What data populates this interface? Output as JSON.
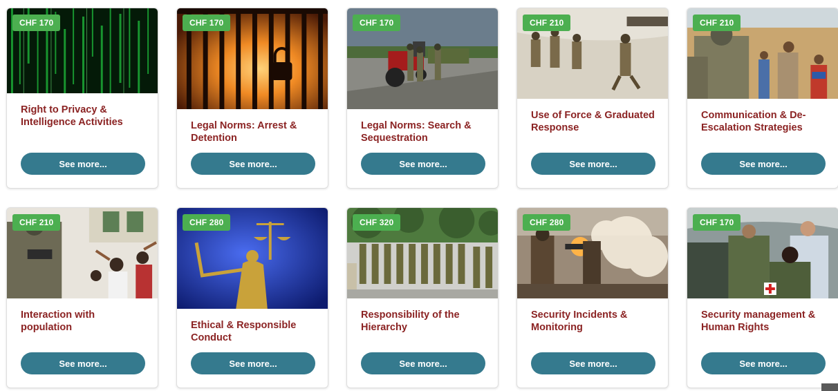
{
  "courses": [
    {
      "price": "CHF 170",
      "title": "Right to Privacy & Intelligence Activities",
      "button": "See more..."
    },
    {
      "price": "CHF 170",
      "title": "Legal Norms: Arrest & Detention",
      "button": "See more..."
    },
    {
      "price": "CHF 170",
      "title": "Legal Norms: Search & Sequestration",
      "button": "See more..."
    },
    {
      "price": "CHF 210",
      "title": "Use of Force & Graduated Response",
      "button": "See more..."
    },
    {
      "price": "CHF 210",
      "title": "Communication & De-Escalation Strategies",
      "button": "See more..."
    },
    {
      "price": "CHF 210",
      "title": "Interaction with population",
      "button": "See more..."
    },
    {
      "price": "CHF 280",
      "title": "Ethical & Responsible Conduct",
      "button": "See more..."
    },
    {
      "price": "CHF 320",
      "title": "Responsibility of the Hierarchy",
      "button": "See more..."
    },
    {
      "price": "CHF 280",
      "title": "Security Incidents & Monitoring",
      "button": "See more..."
    },
    {
      "price": "CHF 170",
      "title": "Security management & Human Rights",
      "button": "See more..."
    }
  ],
  "colors": {
    "badge": "#4caf50",
    "title": "#8b2323",
    "button": "#357a8e"
  }
}
